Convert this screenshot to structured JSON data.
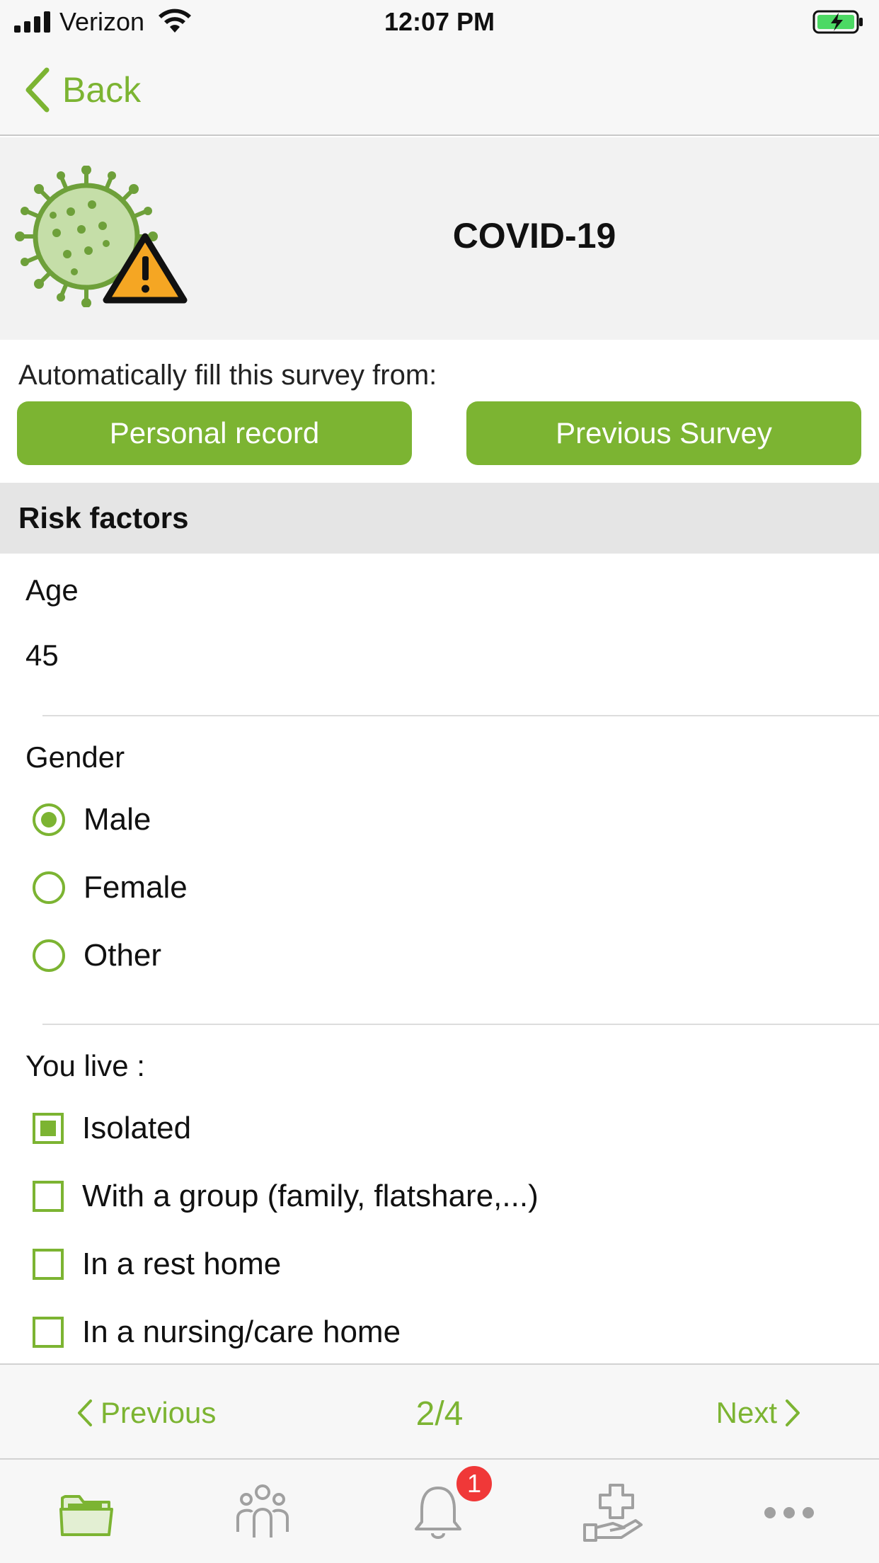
{
  "status_bar": {
    "carrier": "Verizon",
    "time": "12:07 PM"
  },
  "nav": {
    "back_label": "Back"
  },
  "header": {
    "title": "COVID-19",
    "icon": "virus-warning-icon"
  },
  "autofill": {
    "label": "Automatically fill this survey from:",
    "personal_record_label": "Personal record",
    "previous_survey_label": "Previous Survey"
  },
  "section": {
    "title": "Risk factors"
  },
  "age": {
    "label": "Age",
    "value": "45"
  },
  "gender": {
    "label": "Gender",
    "options": [
      "Male",
      "Female",
      "Other"
    ],
    "selected": "Male"
  },
  "living": {
    "label": "You live :",
    "options": [
      "Isolated",
      "With a group (family, flatshare,...)",
      "In a rest home",
      "In a nursing/care home"
    ],
    "checked": [
      "Isolated"
    ]
  },
  "pager": {
    "previous_label": "Previous",
    "count": "2/4",
    "next_label": "Next"
  },
  "tab_bar": {
    "tabs": [
      "folder-icon",
      "people-icon",
      "bell-icon",
      "hand-cross-icon",
      "more-icon"
    ],
    "notification_badge": "1"
  },
  "colors": {
    "accent": "#7cb432",
    "badge": "#f03838",
    "warning": "#f5a623"
  }
}
